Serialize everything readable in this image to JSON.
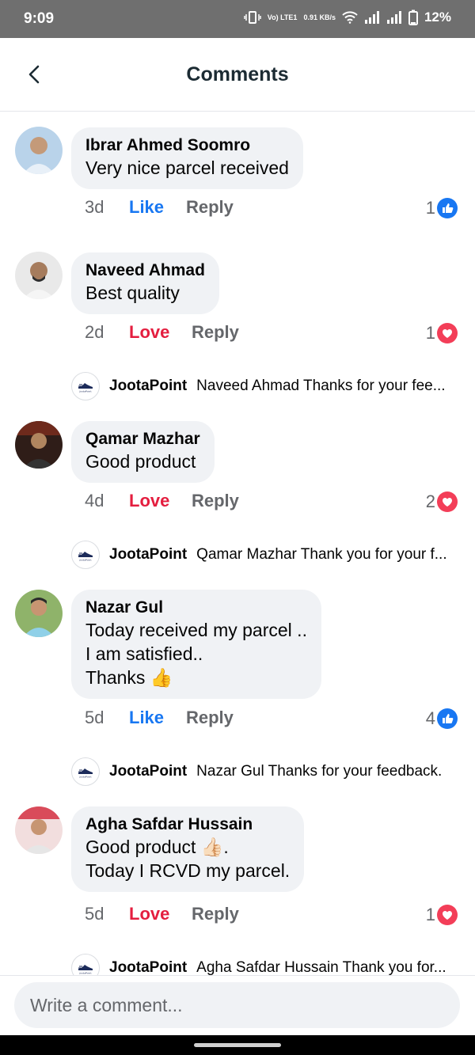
{
  "status_bar": {
    "time": "9:09",
    "network": "Vo) LTE1",
    "speed": "0.91 KB/s",
    "battery": "12%"
  },
  "header": {
    "title": "Comments",
    "back_icon": "chevron-left-icon"
  },
  "comments": [
    {
      "name": "Ibrar Ahmed Soomro",
      "text": "Very nice parcel received",
      "age": "3d",
      "reaction": "Like",
      "reaction_type": "like",
      "reply": "Reply",
      "count": "1"
    },
    {
      "name": "Naveed Ahmad",
      "text": "Best quality",
      "age": "2d",
      "reaction": "Love",
      "reaction_type": "love",
      "reply": "Reply",
      "count": "1",
      "page_reply": {
        "page": "JootaPoint",
        "text": "Naveed Ahmad Thanks for your fee..."
      }
    },
    {
      "name": "Qamar Mazhar",
      "text": "Good product",
      "age": "4d",
      "reaction": "Love",
      "reaction_type": "love",
      "reply": "Reply",
      "count": "2",
      "page_reply": {
        "page": "JootaPoint",
        "text": "Qamar Mazhar Thank you for your f..."
      }
    },
    {
      "name": "Nazar Gul",
      "text": "Today received my parcel ..\nI am satisfied..\nThanks 👍",
      "age": "5d",
      "reaction": "Like",
      "reaction_type": "like",
      "reply": "Reply",
      "count": "4",
      "page_reply": {
        "page": "JootaPoint",
        "text": "Nazar Gul Thanks for your feedback."
      }
    },
    {
      "name": "Agha Safdar Hussain",
      "text": "Good product 👍🏻.\nToday I RCVD my parcel.",
      "age": "5d",
      "reaction": "Love",
      "reaction_type": "love",
      "reply": "Reply",
      "count": "1",
      "page_reply": {
        "page": "JootaPoint",
        "text": "Agha Safdar Hussain Thank you for..."
      }
    }
  ],
  "composer": {
    "placeholder": "Write a comment..."
  },
  "colors": {
    "like": "#1877f2",
    "love": "#e41e3f",
    "bubble": "#f0f2f5"
  }
}
